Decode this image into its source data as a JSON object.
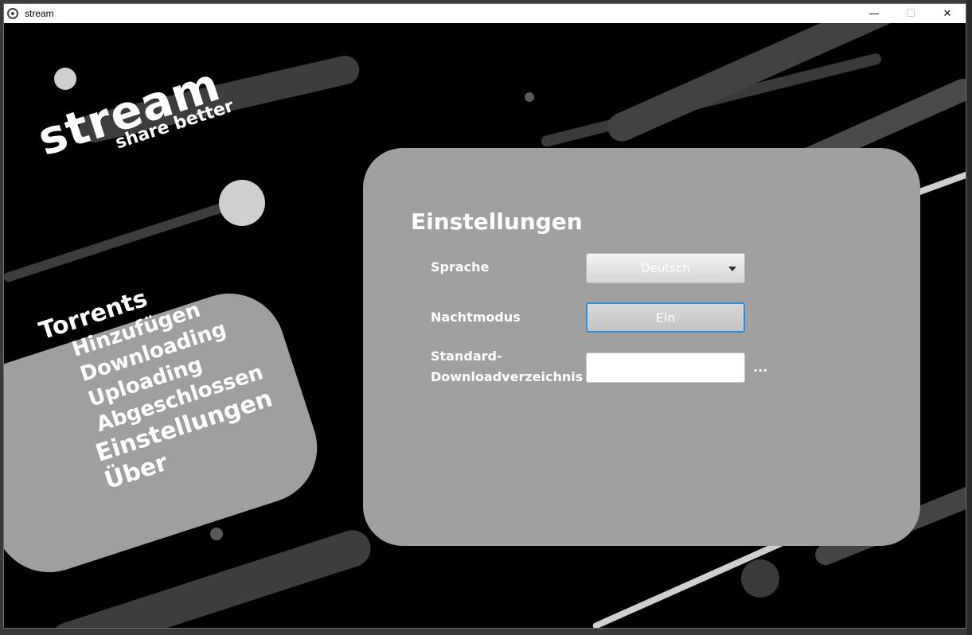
{
  "window": {
    "title": "stream",
    "controls": {
      "minimize": "—",
      "maximize": "☐",
      "close": "✕"
    }
  },
  "logo": {
    "main": "stream",
    "tagline": "share better"
  },
  "nav": {
    "items": [
      {
        "label": "Torrents",
        "level": "main"
      },
      {
        "label": "Hinzufügen",
        "level": "sub"
      },
      {
        "label": "Downloading",
        "level": "sub"
      },
      {
        "label": "Uploading",
        "level": "sub"
      },
      {
        "label": "Abgeschlossen",
        "level": "sub"
      },
      {
        "label": "Einstellungen",
        "level": "main"
      },
      {
        "label": "Über",
        "level": "main"
      }
    ]
  },
  "settings": {
    "title": "Einstellungen",
    "language_label": "Sprache",
    "language_value": "Deutsch",
    "night_mode_label": "Nachtmodus",
    "night_mode_value": "Ein",
    "download_dir_label_line1": "Standard-",
    "download_dir_label_line2": "Downloadverzeichnis",
    "download_dir_value": "",
    "browse_label": "..."
  },
  "colors": {
    "background": "#000000",
    "panel": "#a0a0a0",
    "text": "#ffffff",
    "accent": "#2f8fd4"
  }
}
